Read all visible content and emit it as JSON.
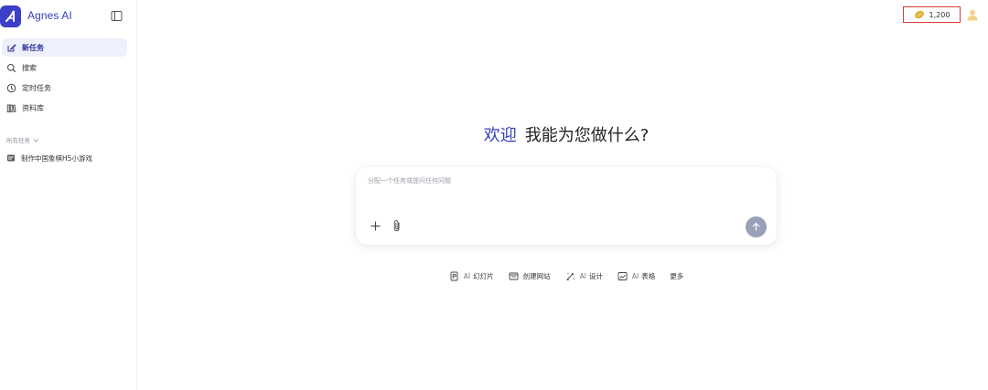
{
  "app": {
    "name": "Agnes AI",
    "accent": "#3540b8"
  },
  "nav": {
    "items": [
      {
        "label": "新任务",
        "icon": "edit-icon",
        "active": true
      },
      {
        "label": "搜索",
        "icon": "search-icon",
        "active": false
      },
      {
        "label": "定时任务",
        "icon": "clock-icon",
        "active": false
      },
      {
        "label": "资料库",
        "icon": "library-icon",
        "active": false
      }
    ]
  },
  "tasks": {
    "section_title": "所有任务",
    "items": [
      {
        "label": "制作中国象棋H5小游戏",
        "icon": "task-icon"
      }
    ]
  },
  "header": {
    "credits": "1,200"
  },
  "main": {
    "welcome": "欢迎",
    "question": "我能为您做什么?",
    "composer_placeholder": "分配一个任务或提问任何问题"
  },
  "quick_actions": [
    {
      "prefix": "AI",
      "label": "幻灯片",
      "icon": "slides-icon"
    },
    {
      "prefix": "",
      "label": "创建网站",
      "icon": "website-icon"
    },
    {
      "prefix": "AI",
      "label": "设计",
      "icon": "design-icon"
    },
    {
      "prefix": "AI",
      "label": "表格",
      "icon": "sheet-icon"
    },
    {
      "prefix": "",
      "label": "更多",
      "icon": ""
    }
  ]
}
